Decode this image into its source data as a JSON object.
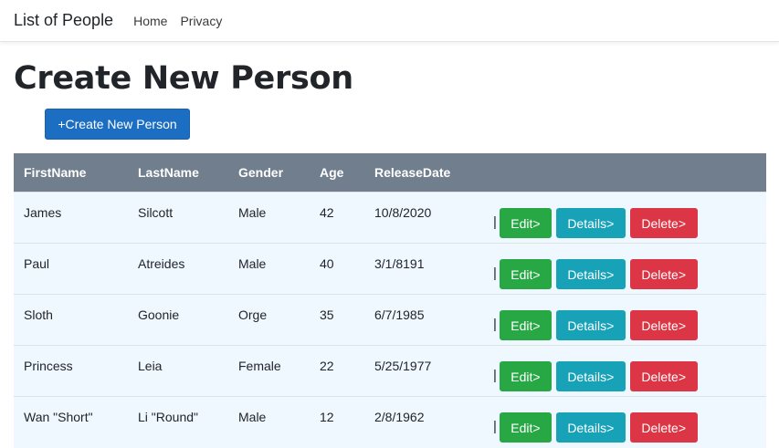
{
  "nav": {
    "brand": "List of People",
    "links": [
      "Home",
      "Privacy"
    ]
  },
  "page": {
    "title": "Create New Person",
    "create_button": "+Create New Person"
  },
  "table": {
    "headers": [
      "FirstName",
      "LastName",
      "Gender",
      "Age",
      "ReleaseDate"
    ],
    "actions": {
      "separator": "|",
      "edit": "Edit>",
      "details": "Details>",
      "delete": "Delete>"
    },
    "rows": [
      [
        "James",
        "Silcott",
        "Male",
        "42",
        "10/8/2020"
      ],
      [
        "Paul",
        "Atreides",
        "Male",
        "40",
        "3/1/8191"
      ],
      [
        "Sloth",
        "Goonie",
        "Orge",
        "35",
        "6/7/1985"
      ],
      [
        "Princess",
        "Leia",
        "Female",
        "22",
        "5/25/1977"
      ],
      [
        "Wan \"Short\"",
        "Li \"Round\"",
        "Male",
        "12",
        "2/8/1962"
      ]
    ]
  },
  "colors": {
    "primary": "#1b6ec2",
    "header_bg": "#707e8d",
    "row_bg": "#f0f8ff",
    "edit": "#28a745",
    "details": "#17a2b8",
    "delete": "#dc3545"
  }
}
